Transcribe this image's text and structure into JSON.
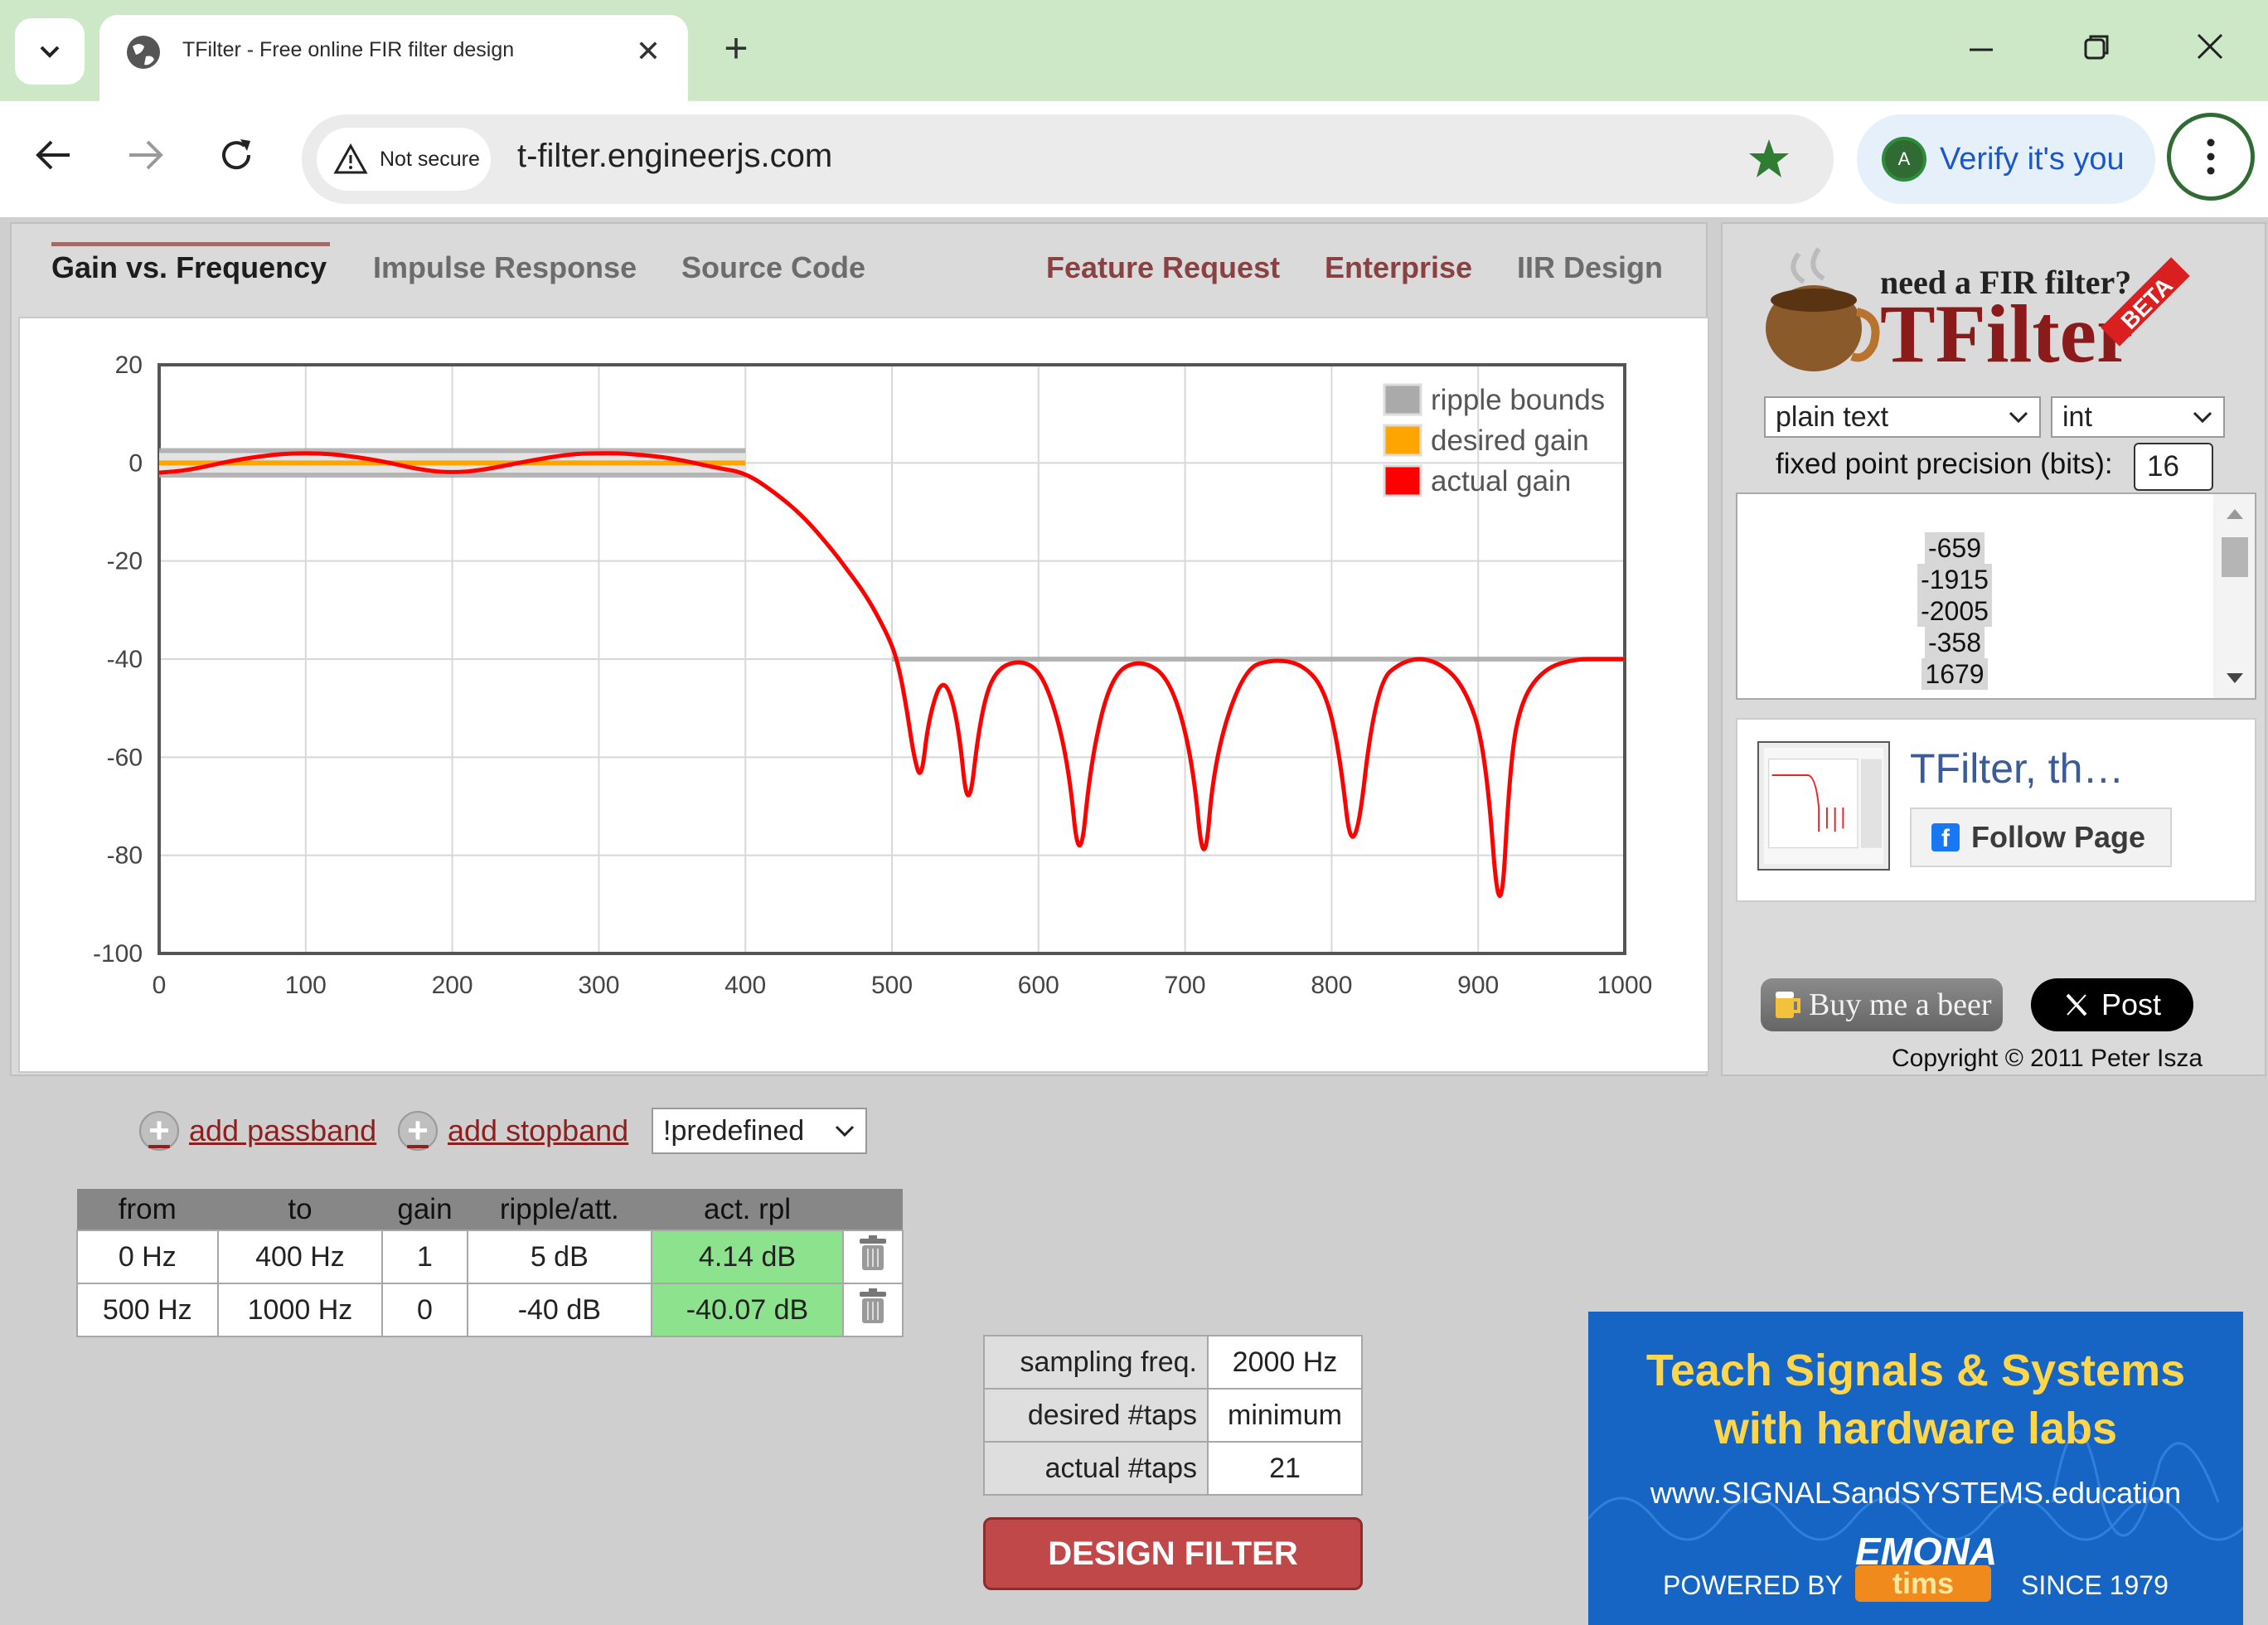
{
  "browser": {
    "tab_title": "TFilter - Free online FIR filter design",
    "security_label": "Not secure",
    "url": "t-filter.engineerjs.com",
    "verify_label": "Verify it's you",
    "avatar_letter": "A"
  },
  "nav": {
    "tabs": [
      "Gain vs. Frequency",
      "Impulse Response",
      "Source Code"
    ],
    "links": [
      "Feature Request",
      "Enterprise",
      "IIR Design"
    ]
  },
  "chart_data": {
    "type": "line",
    "title": "",
    "xlabel": "",
    "ylabel": "",
    "xlim": [
      0,
      1000
    ],
    "ylim": [
      -100,
      20
    ],
    "x_ticks": [
      "0",
      "100",
      "200",
      "300",
      "400",
      "500",
      "600",
      "700",
      "800",
      "900",
      "1000"
    ],
    "y_ticks": [
      "20",
      "0",
      "-20",
      "-40",
      "-60",
      "-80",
      "-100"
    ],
    "grid": true,
    "legend_position": "top-right",
    "legend": [
      "ripple bounds",
      "desired gain",
      "actual gain"
    ],
    "colors": {
      "ripple": "#aaaaaa",
      "desired": "#ffa500",
      "actual": "#ff0000"
    },
    "series": [
      {
        "name": "ripple bounds",
        "segments": [
          {
            "x": [
              0,
              400
            ],
            "y": [
              2.5,
              2.5
            ]
          },
          {
            "x": [
              0,
              400
            ],
            "y": [
              -2.5,
              -2.5
            ]
          },
          {
            "x": [
              500,
              1000
            ],
            "y": [
              -40,
              -40
            ]
          }
        ]
      },
      {
        "name": "desired gain",
        "segments": [
          {
            "x": [
              0,
              400
            ],
            "y": [
              0,
              0
            ]
          }
        ]
      },
      {
        "name": "actual gain",
        "x": [
          0,
          20,
          50,
          80,
          100,
          120,
          150,
          180,
          200,
          220,
          250,
          280,
          300,
          320,
          350,
          380,
          400,
          420,
          440,
          460,
          470,
          480,
          490,
          500,
          505,
          510,
          515,
          520,
          525,
          535,
          545,
          552,
          560,
          570,
          590,
          605,
          620,
          628,
          636,
          650,
          670,
          690,
          705,
          713,
          720,
          740,
          760,
          780,
          795,
          805,
          815,
          830,
          850,
          870,
          890,
          905,
          915,
          922,
          930,
          945,
          965,
          985,
          1000
        ],
        "y": [
          -2,
          -1.5,
          0.5,
          1.8,
          2,
          1.8,
          0.5,
          -1.5,
          -2,
          -1.5,
          0.3,
          1.8,
          2,
          1.9,
          1,
          -1,
          -2,
          -6,
          -11,
          -18,
          -22,
          -26,
          -31,
          -37,
          -42,
          -50,
          -60,
          -65,
          -52,
          -43,
          -52,
          -73,
          -52,
          -42,
          -40,
          -44,
          -60,
          -84,
          -60,
          -43,
          -40,
          -44,
          -60,
          -85,
          -60,
          -42,
          -40,
          -41,
          -46,
          -58,
          -84,
          -45,
          -40,
          -40,
          -45,
          -58,
          -98,
          -60,
          -48,
          -42,
          -40,
          -40,
          -40
        ]
      }
    ]
  },
  "side": {
    "logo_tagline": "need a FIR filter?",
    "logo_name": "TFilter",
    "logo_badge": "BETA",
    "format_value": "plain text",
    "type_value": "int",
    "precision_label": "fixed point precision (bits):",
    "precision_value": "16",
    "coefficients": [
      "-659",
      "-1915",
      "-2005",
      "-358",
      "1679"
    ],
    "fb_title": "TFilter, th…",
    "fb_follow": "Follow Page",
    "beer_label": "Buy me a beer",
    "post_label": "Post",
    "copyright": "Copyright © 2011 Peter Isza"
  },
  "controls": {
    "add_passband": "add passband",
    "add_stopband": "add stopband",
    "predefined": "!predefined",
    "bands_headers": [
      "from",
      "to",
      "gain",
      "ripple/att.",
      "act. rpl"
    ],
    "bands": [
      {
        "from": "0 Hz",
        "to": "400 Hz",
        "gain": "1",
        "ripple": "5 dB",
        "actual": "4.14 dB"
      },
      {
        "from": "500 Hz",
        "to": "1000 Hz",
        "gain": "0",
        "ripple": "-40 dB",
        "actual": "-40.07 dB"
      }
    ],
    "params": [
      {
        "label": "sampling freq.",
        "value": "2000 Hz"
      },
      {
        "label": "desired #taps",
        "value": "minimum"
      },
      {
        "label": "actual #taps",
        "value": "21"
      }
    ],
    "design_button": "DESIGN FILTER"
  },
  "ad": {
    "line1": "Teach Signals & Systems",
    "line2": "with hardware labs",
    "url": "www.SIGNALSandSYSTEMS.education",
    "powered": "POWERED BY",
    "brand": "EMONA",
    "brand_sub": "tims",
    "since": "SINCE 1979"
  }
}
